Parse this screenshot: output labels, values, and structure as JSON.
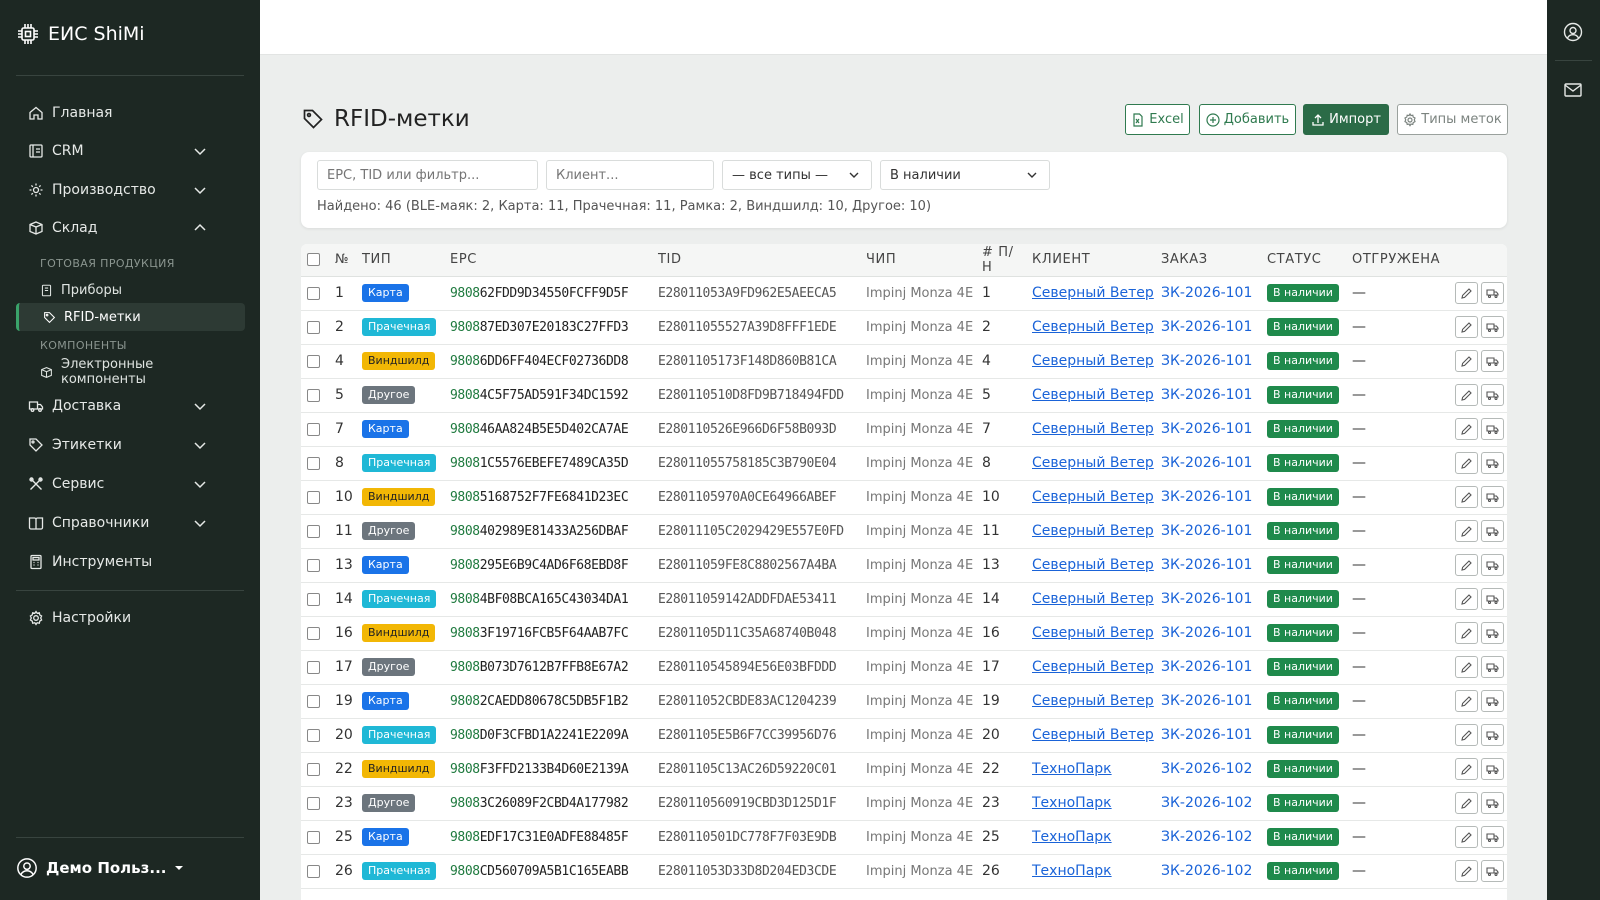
{
  "app": {
    "title": "ЕИС ShiMi"
  },
  "sidebar": {
    "items": [
      {
        "label": "Главная",
        "icon": "home-icon"
      },
      {
        "label": "CRM",
        "icon": "crm-icon"
      },
      {
        "label": "Производство",
        "icon": "gear-icon"
      },
      {
        "label": "Склад",
        "icon": "box-icon"
      },
      {
        "label": "Доставка",
        "icon": "truck-icon"
      },
      {
        "label": "Этикетки",
        "icon": "tag-icon"
      },
      {
        "label": "Сервис",
        "icon": "tools-icon"
      },
      {
        "label": "Справочники",
        "icon": "book-icon"
      },
      {
        "label": "Инструменты",
        "icon": "calculator-icon"
      },
      {
        "label": "Настройки",
        "icon": "settings-icon"
      }
    ],
    "groups": {
      "finished": "ГОТОВАЯ ПРОДУКЦИЯ",
      "components": "КОМПОНЕНТЫ"
    },
    "subitems": {
      "devices": "Приборы",
      "rfid": "RFID-метки",
      "electronic": "Электронные компоненты"
    },
    "user": "Демо Польз..."
  },
  "page": {
    "title": "RFID-метки",
    "buttons": {
      "excel": "Excel",
      "add": "Добавить",
      "import": "Импорт",
      "types": "Типы меток"
    }
  },
  "filters": {
    "search_placeholder": "EPC, TID или фильтр...",
    "client_placeholder": "Клиент...",
    "type_value": "— все типы —",
    "status_value": "В наличии",
    "summary": "Найдено: 46 (BLE-маяк: 2, Карта: 11, Прачечная: 11, Рамка: 2, Виндшилд: 10, Другое: 10)"
  },
  "table": {
    "headers": {
      "no": "№",
      "type": "ТИП",
      "epc": "EPC",
      "tid": "TID",
      "chip": "ЧИП",
      "pn": "# П/Н",
      "client": "КЛИЕНТ",
      "order": "ЗАКАЗ",
      "status": "СТАТУС",
      "shipped": "ОТГРУЖЕНА"
    },
    "type_colors": {
      "Карта": "#1a73e8",
      "Прачечная": "#1fb8d6",
      "Виндшилд": "#f2b705",
      "Другое": "#6c757d"
    },
    "type_text_colors": {
      "Карта": "#ffffff",
      "Прачечная": "#ffffff",
      "Виндшилд": "#222222",
      "Другое": "#ffffff"
    },
    "rows": [
      {
        "no": "1",
        "type": "Карта",
        "epc_prefix": "9808",
        "epc_rest": "62FDD9D34550FCFF9D5F",
        "tid": "E28011053A9FD962E5AEECA5",
        "chip": "Impinj Monza 4E",
        "pn": "1",
        "client": "Северный Ветер",
        "order": "ЗК-2026-101",
        "status": "В наличии",
        "shipped": "—"
      },
      {
        "no": "2",
        "type": "Прачечная",
        "epc_prefix": "9808",
        "epc_rest": "87ED307E20183C27FFD3",
        "tid": "E28011055527A39D8FFF1EDE",
        "chip": "Impinj Monza 4E",
        "pn": "2",
        "client": "Северный Ветер",
        "order": "ЗК-2026-101",
        "status": "В наличии",
        "shipped": "—"
      },
      {
        "no": "4",
        "type": "Виндшилд",
        "epc_prefix": "9808",
        "epc_rest": "6DD6FF404ECF02736DD8",
        "tid": "E2801105173F148D860B81CA",
        "chip": "Impinj Monza 4E",
        "pn": "4",
        "client": "Северный Ветер",
        "order": "ЗК-2026-101",
        "status": "В наличии",
        "shipped": "—"
      },
      {
        "no": "5",
        "type": "Другое",
        "epc_prefix": "9808",
        "epc_rest": "4C5F75AD591F34DC1592",
        "tid": "E280110510D8FD9B718494FDD",
        "chip": "Impinj Monza 4E",
        "pn": "5",
        "client": "Северный Ветер",
        "order": "ЗК-2026-101",
        "status": "В наличии",
        "shipped": "—"
      },
      {
        "no": "7",
        "type": "Карта",
        "epc_prefix": "9808",
        "epc_rest": "46AA824B5E5D402CA7AE",
        "tid": "E280110526E966D6F58B093D",
        "chip": "Impinj Monza 4E",
        "pn": "7",
        "client": "Северный Ветер",
        "order": "ЗК-2026-101",
        "status": "В наличии",
        "shipped": "—"
      },
      {
        "no": "8",
        "type": "Прачечная",
        "epc_prefix": "9808",
        "epc_rest": "1C5576EBEFE7489CA35D",
        "tid": "E28011055758185C3B790E04",
        "chip": "Impinj Monza 4E",
        "pn": "8",
        "client": "Северный Ветер",
        "order": "ЗК-2026-101",
        "status": "В наличии",
        "shipped": "—"
      },
      {
        "no": "10",
        "type": "Виндшилд",
        "epc_prefix": "9808",
        "epc_rest": "5168752F7FE6841D23EC",
        "tid": "E2801105970A0CE64966ABEF",
        "chip": "Impinj Monza 4E",
        "pn": "10",
        "client": "Северный Ветер",
        "order": "ЗК-2026-101",
        "status": "В наличии",
        "shipped": "—"
      },
      {
        "no": "11",
        "type": "Другое",
        "epc_prefix": "9808",
        "epc_rest": "402989E81433A256DBAF",
        "tid": "E28011105C2029429E557E0FD",
        "chip": "Impinj Monza 4E",
        "pn": "11",
        "client": "Северный Ветер",
        "order": "ЗК-2026-101",
        "status": "В наличии",
        "shipped": "—"
      },
      {
        "no": "13",
        "type": "Карта",
        "epc_prefix": "9808",
        "epc_rest": "295E6B9C4AD6F68EBD8F",
        "tid": "E28011059FE8C8802567A4BA",
        "chip": "Impinj Monza 4E",
        "pn": "13",
        "client": "Северный Ветер",
        "order": "ЗК-2026-101",
        "status": "В наличии",
        "shipped": "—"
      },
      {
        "no": "14",
        "type": "Прачечная",
        "epc_prefix": "9808",
        "epc_rest": "4BF08BCA165C43034DA1",
        "tid": "E28011059142ADDFDAE53411",
        "chip": "Impinj Monza 4E",
        "pn": "14",
        "client": "Северный Ветер",
        "order": "ЗК-2026-101",
        "status": "В наличии",
        "shipped": "—"
      },
      {
        "no": "16",
        "type": "Виндшилд",
        "epc_prefix": "9808",
        "epc_rest": "3F19716FCB5F64AAB7FC",
        "tid": "E2801105D11C35A68740B048",
        "chip": "Impinj Monza 4E",
        "pn": "16",
        "client": "Северный Ветер",
        "order": "ЗК-2026-101",
        "status": "В наличии",
        "shipped": "—"
      },
      {
        "no": "17",
        "type": "Другое",
        "epc_prefix": "9808",
        "epc_rest": "B073D7612B7FFB8E67A2",
        "tid": "E280110545894E56E03BFDDD",
        "chip": "Impinj Monza 4E",
        "pn": "17",
        "client": "Северный Ветер",
        "order": "ЗК-2026-101",
        "status": "В наличии",
        "shipped": "—"
      },
      {
        "no": "19",
        "type": "Карта",
        "epc_prefix": "9808",
        "epc_rest": "2CAEDD80678C5DB5F1B2",
        "tid": "E28011052CBDE83AC1204239",
        "chip": "Impinj Monza 4E",
        "pn": "19",
        "client": "Северный Ветер",
        "order": "ЗК-2026-101",
        "status": "В наличии",
        "shipped": "—"
      },
      {
        "no": "20",
        "type": "Прачечная",
        "epc_prefix": "9808",
        "epc_rest": "D0F3CFBD1A2241E2209A",
        "tid": "E2801105E5B6F7CC39956D76",
        "chip": "Impinj Monza 4E",
        "pn": "20",
        "client": "Северный Ветер",
        "order": "ЗК-2026-101",
        "status": "В наличии",
        "shipped": "—"
      },
      {
        "no": "22",
        "type": "Виндшилд",
        "epc_prefix": "9808",
        "epc_rest": "F3FFD2133B4D60E2139A",
        "tid": "E2801105C13AC26D59220C01",
        "chip": "Impinj Monza 4E",
        "pn": "22",
        "client": "ТехноПарк",
        "order": "ЗК-2026-102",
        "status": "В наличии",
        "shipped": "—"
      },
      {
        "no": "23",
        "type": "Другое",
        "epc_prefix": "9808",
        "epc_rest": "3C26089F2CBD4A177982",
        "tid": "E280110560919CBD3D125D1F",
        "chip": "Impinj Monza 4E",
        "pn": "23",
        "client": "ТехноПарк",
        "order": "ЗК-2026-102",
        "status": "В наличии",
        "shipped": "—"
      },
      {
        "no": "25",
        "type": "Карта",
        "epc_prefix": "9808",
        "epc_rest": "EDF17C31E0ADFE88485F",
        "tid": "E280110501DC778F7F03E9DB",
        "chip": "Impinj Monza 4E",
        "pn": "25",
        "client": "ТехноПарк",
        "order": "ЗК-2026-102",
        "status": "В наличии",
        "shipped": "—"
      },
      {
        "no": "26",
        "type": "Прачечная",
        "epc_prefix": "9808",
        "epc_rest": "CD560709A5B1C165EABB",
        "tid": "E28011053D33D8D204ED3CDE",
        "chip": "Impinj Monza 4E",
        "pn": "26",
        "client": "ТехноПарк",
        "order": "ЗК-2026-102",
        "status": "В наличии",
        "shipped": "—"
      }
    ]
  }
}
